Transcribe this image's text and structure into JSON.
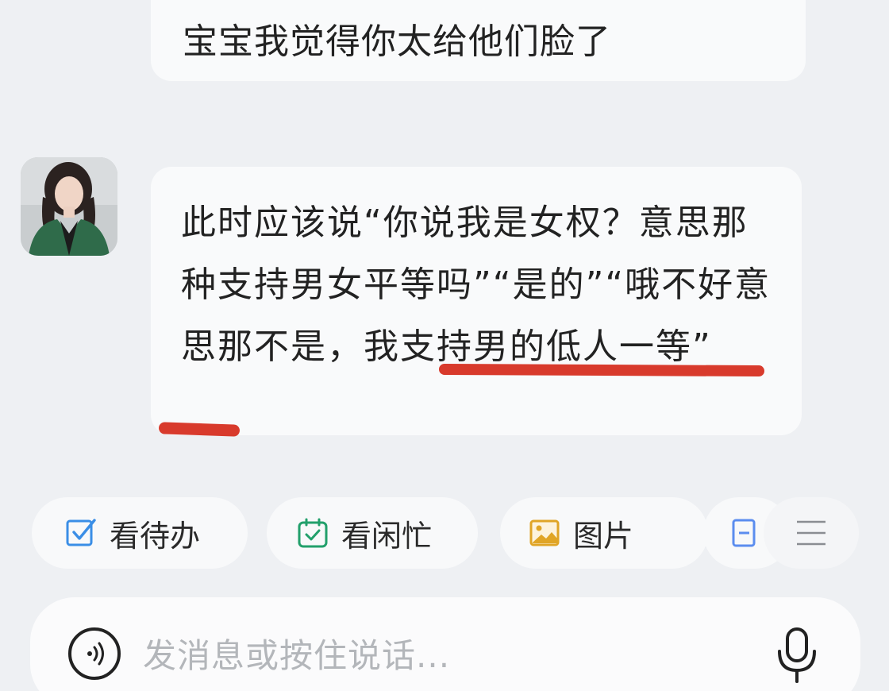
{
  "chat": {
    "prev_message": "宝宝我觉得你太给他们脸了",
    "reply": {
      "part1": "此时应该说“你说我是女权？意思那种支持男女平等吗”“是的”“哦不好意思那不是，",
      "highlight": "我支持男的低人一等",
      "part2": "”"
    }
  },
  "quick_actions": [
    {
      "label": "看待办",
      "icon": "todo-check-icon",
      "color": "#3a8ee6"
    },
    {
      "label": "看闲忙",
      "icon": "calendar-check-icon",
      "color": "#22a06b"
    },
    {
      "label": "图片",
      "icon": "image-icon",
      "color": "#e0a526"
    },
    {
      "label": "",
      "icon": "doc-icon",
      "color": "#5b8def"
    }
  ],
  "input": {
    "placeholder": "发消息或按住说话..."
  },
  "colors": {
    "annotation": "#d83a2c"
  }
}
